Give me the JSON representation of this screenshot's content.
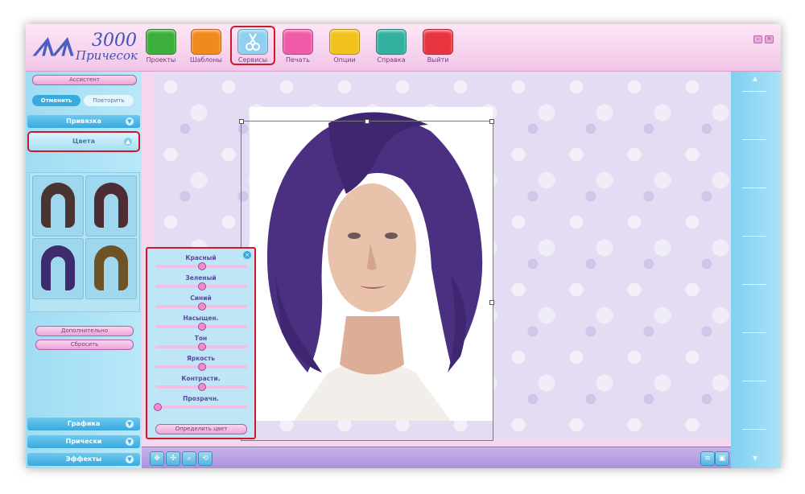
{
  "app": {
    "logo_number": "3000",
    "logo_word": "Причесок"
  },
  "toolbar": [
    {
      "label": "Проекты",
      "icon": "projects-icon",
      "color": "#3cae3c"
    },
    {
      "label": "Шаблоны",
      "icon": "templates-icon",
      "color": "#f08a1c"
    },
    {
      "label": "Сервисы",
      "icon": "scissors-icon",
      "color": "#8fd0f0",
      "highlighted": true
    },
    {
      "label": "Печать",
      "icon": "print-icon",
      "color": "#ee5aa8"
    },
    {
      "label": "Опции",
      "icon": "options-icon",
      "color": "#f2c21c"
    },
    {
      "label": "Справка",
      "icon": "help-icon",
      "color": "#34b0a0"
    },
    {
      "label": "Выйти",
      "icon": "exit-icon",
      "color": "#e8343e"
    }
  ],
  "left": {
    "assistant": "Ассистент",
    "undo": "Отменить",
    "redo": "Повторить",
    "snap": "Привязка",
    "colors": "Цвета",
    "more": "Дополнительно",
    "reset": "Сбросить",
    "graphics": "Графика",
    "hairstyles": "Прически",
    "effects": "Эффекты"
  },
  "swatch_colors": [
    "#4a3432",
    "#4d2c34",
    "#3e2b6e",
    "#6e5326"
  ],
  "color_dialog": {
    "sliders": [
      {
        "label": "Красный",
        "value": 0.5
      },
      {
        "label": "Зеленый",
        "value": 0.5
      },
      {
        "label": "Синий",
        "value": 0.5
      },
      {
        "label": "Насыщен.",
        "value": 0.5
      },
      {
        "label": "Тон",
        "value": 0.5
      },
      {
        "label": "Яркость",
        "value": 0.5
      },
      {
        "label": "Контрасти.",
        "value": 0.5
      },
      {
        "label": "Прозрачн.",
        "value": 0.02
      }
    ],
    "detect_button": "Определить цвет"
  },
  "colors": {
    "hair": "#4b2f80",
    "skin": "#e8c2aa",
    "accent_red": "#cc1a2a"
  }
}
